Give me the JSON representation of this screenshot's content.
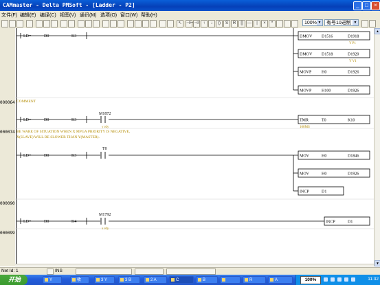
{
  "window": {
    "title": "CAMmaster - Delta PMSoft - [Ladder - P2]",
    "minimize": "_",
    "maximize": "□",
    "close": "×"
  },
  "menu": [
    "文件(F)",
    "编辑(E)",
    "编译(C)",
    "视图(V)",
    "通讯(M)",
    "选项(O)",
    "窗口(W)",
    "帮助(H)"
  ],
  "toolbar": {
    "zoom": "100%",
    "mode": "有号10进制"
  },
  "rungs": [
    {
      "step": "",
      "cond_op": "LD=",
      "cond_a": "D0",
      "cond_b": "K3",
      "outputs": [
        {
          "op": "DMOV",
          "a": "D1516",
          "b": "D1918",
          "note": "Y P1"
        },
        {
          "op": "DMOV",
          "a": "D1518",
          "b": "D1920",
          "note": "Y V1"
        },
        {
          "op": "MOVP",
          "a": "H0",
          "b": "D1926",
          "note": ""
        },
        {
          "op": "MOVP",
          "a": "H100",
          "b": "D1926",
          "note": ""
        }
      ]
    },
    {
      "step": "000064",
      "comment": "COMMENT",
      "cond_op": "LD=",
      "cond_a": "D0",
      "cond_b": "K3",
      "contact": "M1872",
      "contact_note": "y rdy",
      "outputs": [
        {
          "op": "TMR",
          "a": "T0",
          "b": "K10",
          "note": "100MS"
        }
      ]
    },
    {
      "step": "000074",
      "comment": "BE WARE OF SITUATION WHEN X MPGA PRIORITY IS NEGATIVE, X(SLAVE) WILL BE SLOWER THAN Y(MASTER).",
      "comment2": "X(SLAVE) WILL BE SLOWER THAN Y(MASTER).",
      "comment1": "BE WARE OF SITUATION WHEN X MPGA PRIORITY IS NEGATIVE,",
      "cond_op": "LD=",
      "cond_a": "D0",
      "cond_b": "K3",
      "contact": "T0",
      "outputs": [
        {
          "op": "MOV",
          "a": "H0",
          "b": "D1846",
          "note": ""
        },
        {
          "op": "MOV",
          "a": "H0",
          "b": "D1926",
          "note": ""
        },
        {
          "op": "INCP",
          "a": "D1",
          "b": "",
          "note": ""
        }
      ]
    },
    {
      "step": "000090",
      "cond_op": "LD=",
      "cond_a": "D0",
      "cond_b": "K4",
      "contact": "M1792",
      "contact_note": "x rdy",
      "outputs": [
        {
          "op": "INCP",
          "a": "D1",
          "b": "",
          "note": ""
        }
      ]
    },
    {
      "step": "000099"
    }
  ],
  "status": {
    "netid": "Net Id: 1",
    "mode": "INS"
  },
  "taskbar": {
    "start": "开始",
    "tasks": [
      "Y",
      "收",
      "3 Y",
      "3 B",
      "2 A",
      "C",
      "B",
      "",
      "R",
      "A"
    ],
    "zoom": "100%",
    "clock": "11:32"
  }
}
